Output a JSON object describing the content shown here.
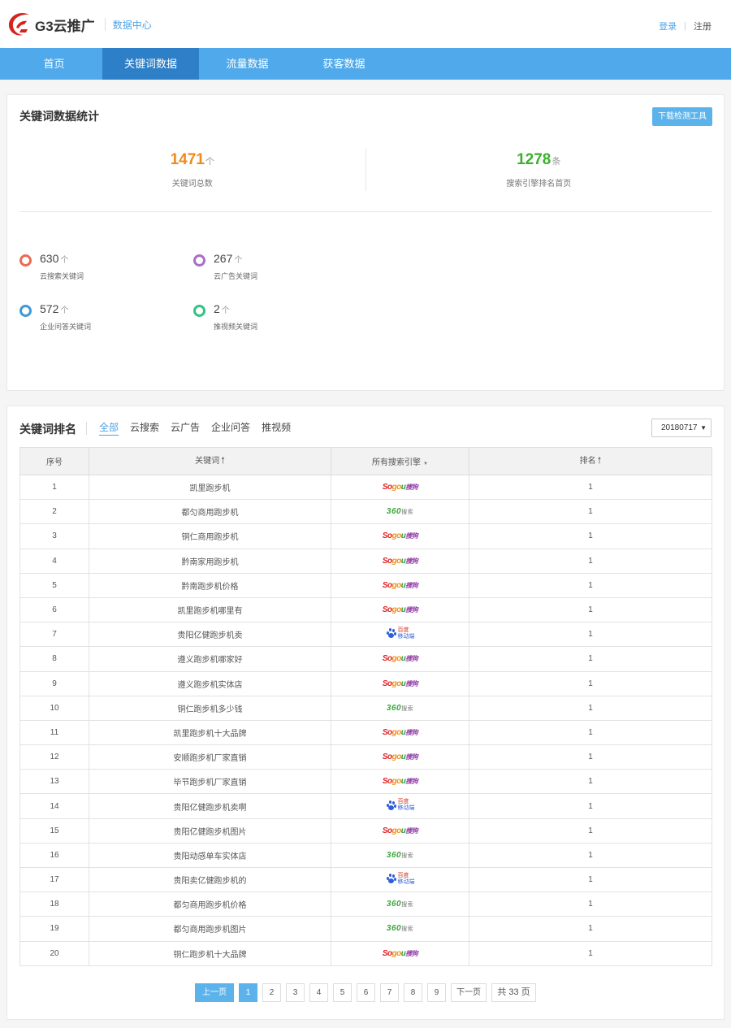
{
  "header": {
    "logo_text": "G3云推广",
    "subtitle": "数据中心",
    "login": "登录",
    "register": "注册"
  },
  "nav": {
    "items": [
      {
        "label": "首页",
        "active": false
      },
      {
        "label": "关键词数据",
        "active": true
      },
      {
        "label": "流量数据",
        "active": false
      },
      {
        "label": "获客数据",
        "active": false
      }
    ]
  },
  "stats": {
    "title": "关键词数据统计",
    "download_button": "下载检测工具",
    "total": {
      "value": "1471",
      "unit": "个",
      "label": "关键词总数"
    },
    "first_page": {
      "value": "1278",
      "unit": "条",
      "label": "搜索引擎排名首页"
    },
    "categories": [
      {
        "value": "630",
        "unit": "个",
        "label": "云搜索关键词",
        "color": "#ea6c53"
      },
      {
        "value": "267",
        "unit": "个",
        "label": "云广告关键词",
        "color": "#ab6fc3"
      },
      {
        "value": "572",
        "unit": "个",
        "label": "企业问答关键词",
        "color": "#3d9ad9"
      },
      {
        "value": "2",
        "unit": "个",
        "label": "推视频关键词",
        "color": "#33c382"
      }
    ]
  },
  "ranking": {
    "title": "关键词排名",
    "filters": [
      "全部",
      "云搜索",
      "云广告",
      "企业问答",
      "推视频"
    ],
    "active_filter": "全部",
    "date": "20180717",
    "columns": {
      "no": "序号",
      "keyword": "关键词",
      "engine": "所有搜索引擎",
      "rank": "排名"
    },
    "engine_labels": {
      "sogou_a": "So",
      "sogou_b": "go",
      "sogou_c": "u",
      "sogou_d": "搜狗",
      "s360_a": "360",
      "s360_b": "搜索",
      "baidu_a": "百度",
      "baidu_b": "移动端"
    },
    "rows": [
      {
        "no": "1",
        "keyword": "凯里跑步机",
        "engine": "sogou",
        "rank": "1"
      },
      {
        "no": "2",
        "keyword": "都匀商用跑步机",
        "engine": "360",
        "rank": "1"
      },
      {
        "no": "3",
        "keyword": "铜仁商用跑步机",
        "engine": "sogou",
        "rank": "1"
      },
      {
        "no": "4",
        "keyword": "黔南家用跑步机",
        "engine": "sogou",
        "rank": "1"
      },
      {
        "no": "5",
        "keyword": "黔南跑步机价格",
        "engine": "sogou",
        "rank": "1"
      },
      {
        "no": "6",
        "keyword": "凯里跑步机哪里有",
        "engine": "sogou",
        "rank": "1"
      },
      {
        "no": "7",
        "keyword": "贵阳亿健跑步机卖",
        "engine": "baidu",
        "rank": "1"
      },
      {
        "no": "8",
        "keyword": "遵义跑步机哪家好",
        "engine": "sogou",
        "rank": "1"
      },
      {
        "no": "9",
        "keyword": "遵义跑步机实体店",
        "engine": "sogou",
        "rank": "1"
      },
      {
        "no": "10",
        "keyword": "铜仁跑步机多少钱",
        "engine": "360",
        "rank": "1"
      },
      {
        "no": "11",
        "keyword": "凯里跑步机十大品牌",
        "engine": "sogou",
        "rank": "1"
      },
      {
        "no": "12",
        "keyword": "安顺跑步机厂家直销",
        "engine": "sogou",
        "rank": "1"
      },
      {
        "no": "13",
        "keyword": "毕节跑步机厂家直销",
        "engine": "sogou",
        "rank": "1"
      },
      {
        "no": "14",
        "keyword": "贵阳亿健跑步机卖啊",
        "engine": "baidu",
        "rank": "1"
      },
      {
        "no": "15",
        "keyword": "贵阳亿健跑步机图片",
        "engine": "sogou",
        "rank": "1"
      },
      {
        "no": "16",
        "keyword": "贵阳动感单车实体店",
        "engine": "360",
        "rank": "1"
      },
      {
        "no": "17",
        "keyword": "贵阳卖亿健跑步机的",
        "engine": "baidu",
        "rank": "1"
      },
      {
        "no": "18",
        "keyword": "都匀商用跑步机价格",
        "engine": "360",
        "rank": "1"
      },
      {
        "no": "19",
        "keyword": "都匀商用跑步机图片",
        "engine": "360",
        "rank": "1"
      },
      {
        "no": "20",
        "keyword": "铜仁跑步机十大品牌",
        "engine": "sogou",
        "rank": "1"
      }
    ]
  },
  "pagination": {
    "prev": "上一页",
    "pages": [
      "1",
      "2",
      "3",
      "4",
      "5",
      "6",
      "7",
      "8",
      "9"
    ],
    "current": "1",
    "next": "下一页",
    "total": "共 33 页"
  }
}
